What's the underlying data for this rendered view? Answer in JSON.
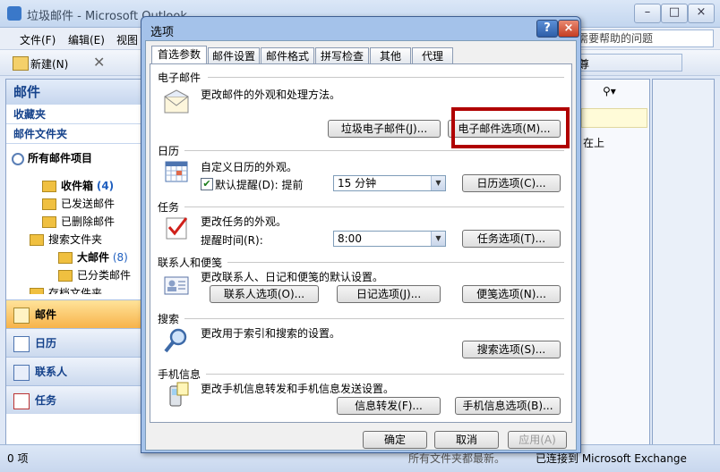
{
  "main_window": {
    "title": "垃圾邮件 - Microsoft Outlook",
    "menus": [
      "文件(F)",
      "编辑(E)",
      "视图"
    ],
    "help_placeholder": "需要帮助的问题",
    "toolbar_new": "新建(N)",
    "toolbar_partial": "尊"
  },
  "nav": {
    "header": "邮件",
    "favorites": "收藏夹",
    "mail_folders": "邮件文件夹",
    "all_items": "所有邮件项目",
    "folders": [
      {
        "name": "收件箱",
        "count": "(4)"
      },
      {
        "name": "已发送邮件",
        "count": ""
      },
      {
        "name": "已删除邮件",
        "count": ""
      },
      {
        "name": "搜索文件夹",
        "count": ""
      },
      {
        "name": "大邮件",
        "count": "(8)"
      },
      {
        "name": "已分类邮件",
        "count": ""
      },
      {
        "name": "存档文件夹",
        "count": ""
      }
    ],
    "buttons": [
      "邮件",
      "日历",
      "联系人",
      "任务"
    ]
  },
  "right_pane": {
    "col_label": "在上"
  },
  "status": {
    "items": "0 项",
    "mid": "所有文件夹都最新。",
    "exchange": "已连接到 Microsoft Exchange"
  },
  "dialog": {
    "title": "选项",
    "help_btn": "?",
    "close_btn": "×",
    "tabs": [
      "首选参数",
      "邮件设置",
      "邮件格式",
      "拼写检查",
      "其他",
      "代理"
    ],
    "sections": {
      "email": {
        "header": "电子邮件",
        "desc": "更改邮件的外观和处理方法。",
        "btn_junk": "垃圾电子邮件(J)...",
        "btn_options": "电子邮件选项(M)..."
      },
      "calendar": {
        "header": "日历",
        "desc": "自定义日历的外观。",
        "reminder_label": "默认提醒(D): 提前",
        "reminder_value": "15 分钟",
        "btn": "日历选项(C)..."
      },
      "tasks": {
        "header": "任务",
        "desc": "更改任务的外观。",
        "time_label": "提醒时间(R):",
        "time_value": "8:00",
        "btn": "任务选项(T)..."
      },
      "contacts": {
        "header": "联系人和便笺",
        "desc": "更改联系人、日记和便笺的默认设置。",
        "btn_contacts": "联系人选项(O)...",
        "btn_journal": "日记选项(J)...",
        "btn_notes": "便笺选项(N)..."
      },
      "search": {
        "header": "搜索",
        "desc": "更改用于索引和搜索的设置。",
        "btn": "搜索选项(S)..."
      },
      "mobile": {
        "header": "手机信息",
        "desc": "更改手机信息转发和手机信息发送设置。",
        "btn_forward": "信息转发(F)...",
        "btn_options": "手机信息选项(B)..."
      }
    },
    "ok": "确定",
    "cancel": "取消",
    "apply": "应用(A)"
  },
  "colors": {
    "highlight": "#b00000",
    "accent": "#15428b",
    "active_nav": "#f7b34a"
  }
}
